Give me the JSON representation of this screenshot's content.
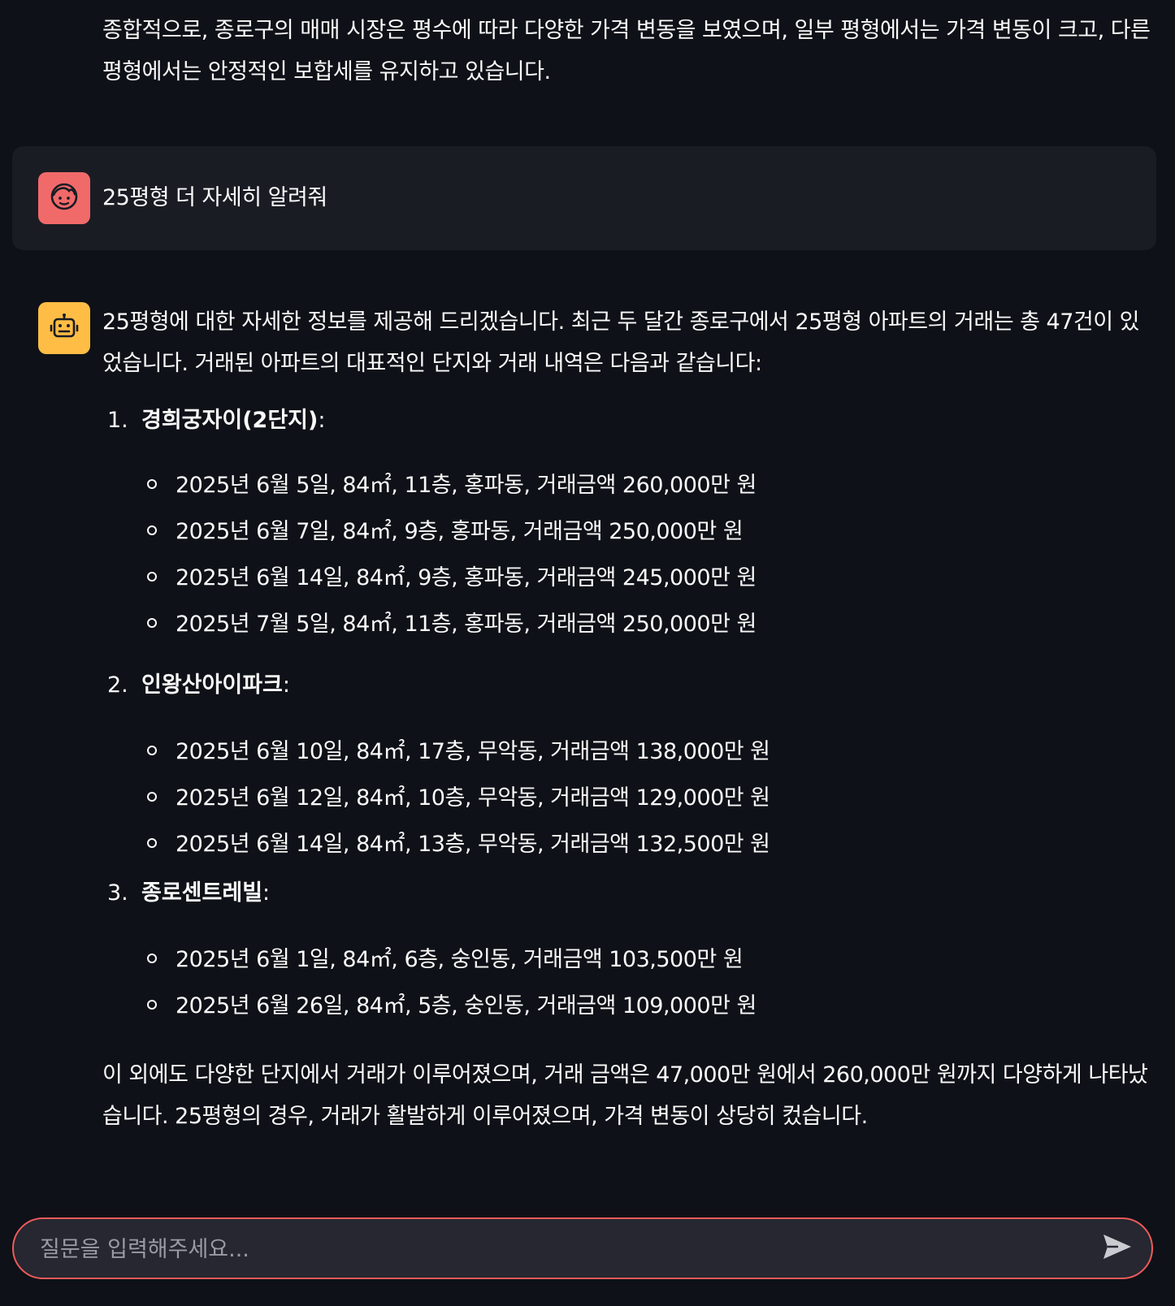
{
  "conversation": {
    "previous_assistant_text": "종합적으로, 종로구의 매매 시장은 평수에 따라 다양한 가격 변동을 보였으며, 일부 평형에서는 가격 변동이 크고, 다른 평형에서는 안정적인 보합세를 유지하고 있습니다.",
    "user_message": {
      "avatar_icon": "user-face-icon",
      "text": "25평형 더 자세히 알려줘"
    },
    "assistant_message": {
      "avatar_icon": "robot-icon",
      "intro": "25평형에 대한 자세한 정보를 제공해 드리겠습니다. 최근 두 달간 종로구에서 25평형 아파트의 거래는 총 47건이 있었습니다. 거래된 아파트의 대표적인 단지와 거래 내역은 다음과 같습니다:",
      "complexes": [
        {
          "number": "1.",
          "name": "경희궁자이(2단지)",
          "deals": [
            "2025년 6월 5일, 84㎡, 11층, 홍파동, 거래금액 260,000만 원",
            "2025년 6월 7일, 84㎡, 9층, 홍파동, 거래금액 250,000만 원",
            "2025년 6월 14일, 84㎡, 9층, 홍파동, 거래금액 245,000만 원",
            "2025년 7월 5일, 84㎡, 11층, 홍파동, 거래금액 250,000만 원"
          ]
        },
        {
          "number": "2.",
          "name": "인왕산아이파크",
          "deals": [
            "2025년 6월 10일, 84㎡, 17층, 무악동, 거래금액 138,000만 원",
            "2025년 6월 12일, 84㎡, 10층, 무악동, 거래금액 129,000만 원",
            "2025년 6월 14일, 84㎡, 13층, 무악동, 거래금액 132,500만 원"
          ]
        },
        {
          "number": "3.",
          "name": "종로센트레빌",
          "deals": [
            "2025년 6월 1일, 84㎡, 6층, 숭인동, 거래금액 103,500만 원",
            "2025년 6월 26일, 84㎡, 5층, 숭인동, 거래금액 109,000만 원"
          ]
        }
      ],
      "summary": "이 외에도 다양한 단지에서 거래가 이루어졌으며, 거래 금액은 47,000만 원에서 260,000만 원까지 다양하게 나타났습니다. 25평형의 경우, 거래가 활발하게 이루어졌으며, 가격 변동이 상당히 컸습니다."
    }
  },
  "chat_input": {
    "placeholder": "질문을 입력해주세요...",
    "value": "",
    "send_icon": "send-icon"
  },
  "colors": {
    "background": "#0e1117",
    "user_bubble": "#1a1c24",
    "user_avatar": "#f06a6a",
    "assistant_avatar": "#ffbd45",
    "input_border": "#ee5a5a",
    "input_background": "#262730"
  }
}
